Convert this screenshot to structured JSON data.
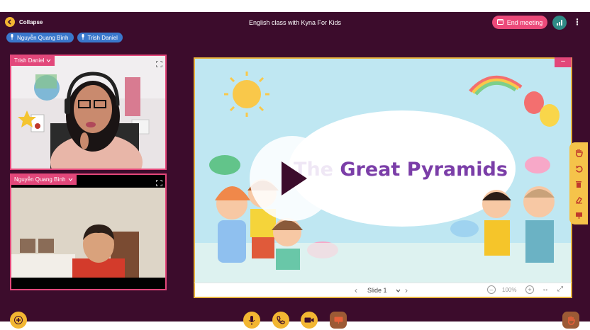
{
  "header": {
    "collapse_label": "Collapse",
    "title": "English class with Kyna For Kids",
    "end_label": "End meeting"
  },
  "participants": [
    {
      "name": "Nguyễn Quang Bình"
    },
    {
      "name": "Trish Daniel"
    }
  ],
  "tiles": {
    "teacher_name": "Trish Daniel",
    "student_name": "Nguyễn Quang Bình"
  },
  "slide": {
    "title": "The Great Pyramids",
    "page_label": "Slide 1",
    "zoom": "100%"
  },
  "colors": {
    "background": "#3c0c2c",
    "accent_pink": "#e2477a",
    "accent_yellow": "#f2b632",
    "chip_blue": "#3a78cc"
  },
  "icons": {
    "toolbar": [
      "hand-icon",
      "undo-icon",
      "trash-icon",
      "eraser-icon",
      "board-icon"
    ],
    "bottom": [
      "add-icon",
      "microphone-icon",
      "phone-icon",
      "camera-icon",
      "screen-share-icon",
      "raise-hand-icon"
    ]
  }
}
